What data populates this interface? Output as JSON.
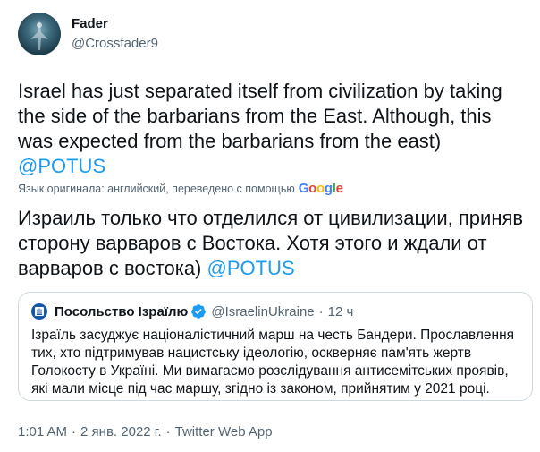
{
  "author": {
    "name": "Fader",
    "handle": "@Crossfader9"
  },
  "tweet": {
    "text": "Israel has just separated itself from civilization by taking the side of the barbarians from the East. Although, this was expected from the barbarians from the east) ",
    "mention": "@POTUS"
  },
  "translation": {
    "note": "Язык оригинала: английский, переведено с помощью",
    "provider": "Google",
    "provider_letters": [
      {
        "char": "G",
        "color": "#4285F4"
      },
      {
        "char": "o",
        "color": "#EA4335"
      },
      {
        "char": "o",
        "color": "#FBBC05"
      },
      {
        "char": "g",
        "color": "#4285F4"
      },
      {
        "char": "l",
        "color": "#34A853"
      },
      {
        "char": "e",
        "color": "#EA4335"
      }
    ],
    "text": "Израиль только что отделился от цивилизации, приняв сторону варваров с Востока. Хотя этого и ждали от варваров с востока) ",
    "mention": "@POTUS"
  },
  "quote": {
    "name": "Посольство Ізраїлю",
    "handle": "@IsraelinUkraine",
    "separator": "·",
    "time": "12 ч",
    "text": "Ізраїль засуджує націоналістичний марш на честь Бандери. Прославлення тих, хто підтримував нацистську ідеологію, оскверняє пам'ять жертв Голокосту в Україні. Ми вимагаємо розслідування антисемітських проявів, які мали місце під час маршу, згідно із законом, прийнятим у 2021 році."
  },
  "meta": {
    "time": "1:01 AM",
    "separator": "·",
    "date": "2 янв. 2022 г.",
    "source": "Twitter Web App"
  },
  "colors": {
    "link": "#1d9bf0",
    "secondary_text": "#536471",
    "verified": "#1d9bf0",
    "border": "#cfd9de"
  },
  "icons": {
    "verified": "verified-badge-icon",
    "quote_avatar": "israel-emblem-icon"
  }
}
